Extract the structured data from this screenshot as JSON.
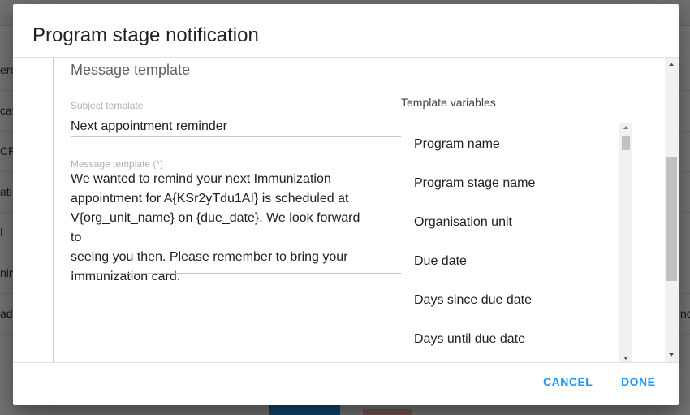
{
  "background": {
    "rows": [
      "ere",
      "cat",
      "CR",
      "ati",
      "l",
      "nin",
      "ad"
    ],
    "right_text": "no"
  },
  "dialog": {
    "title": "Program stage notification",
    "section_title": "Message template",
    "subject": {
      "label": "Subject template",
      "value": "Next appointment reminder"
    },
    "message": {
      "label": "Message template (*)",
      "lines": [
        "We wanted to remind your next Immunization",
        "appointment for A{KSr2yTdu1AI}  is scheduled at",
        "V{org_unit_name} on {due_date}. We look forward to",
        "seeing you then. Please remember to bring your",
        "Immunization card."
      ]
    },
    "template_variables": {
      "title": "Template variables",
      "items": [
        "Program name",
        "Program stage name",
        "Organisation unit",
        "Due date",
        "Days since due date",
        "Days until due date"
      ]
    },
    "actions": {
      "cancel": "CANCEL",
      "done": "DONE"
    }
  },
  "colors": {
    "accent": "#2196f3",
    "scrim": "rgba(0,0,0,0.54)"
  }
}
